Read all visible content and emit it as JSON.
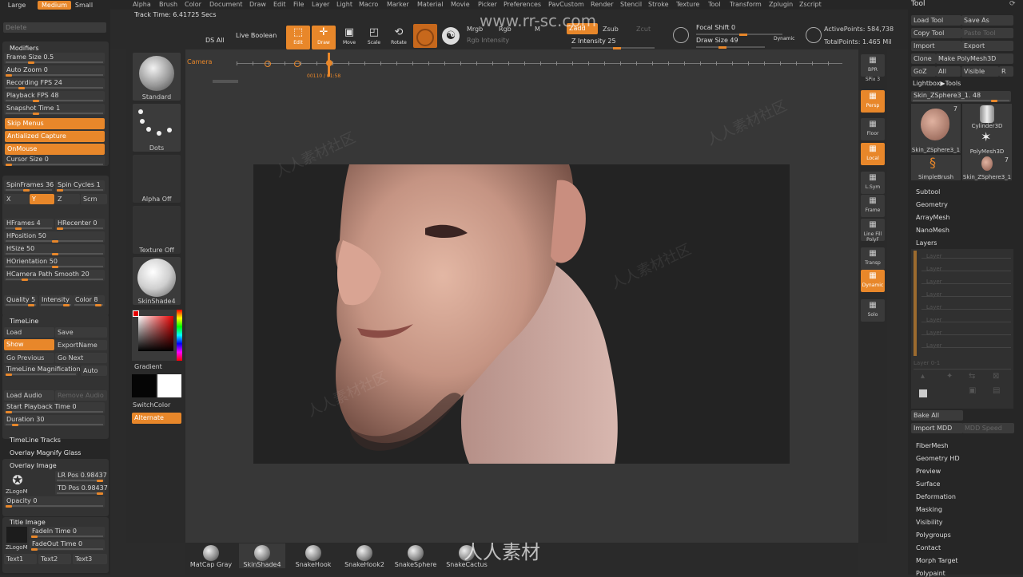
{
  "size_tabs": [
    "Large",
    "Medium",
    "Small"
  ],
  "top_menu": [
    "Alpha",
    "Brush",
    "Color",
    "Document",
    "Draw",
    "Edit",
    "File",
    "Layer",
    "Light",
    "Macro",
    "Marker",
    "Material",
    "Movie",
    "Picker",
    "Preferences",
    "PavCustom",
    "Render",
    "Stencil",
    "Stroke",
    "Texture",
    "Tool",
    "Transform",
    "Zplugin",
    "Zscript"
  ],
  "track_time": "Track Time: 6.41725 Secs",
  "watermark_top": "www.rr-sc.com",
  "watermark_cn": "人人素材社区",
  "watermark_logo": "人人素材",
  "left": {
    "delete": "Delete",
    "modifiers_title": "Modifiers",
    "frame_size": "Frame Size 0.5",
    "auto_zoom": "Auto Zoom 0",
    "recording_fps": "Recording FPS 24",
    "playback_fps": "Playback FPS 48",
    "snapshot_time": "Snapshot Time 1",
    "skip_menus": "Skip Menus",
    "antialized_capture": "Antialized Capture",
    "on_mouse": "OnMouse",
    "cursor_size": "Cursor Size 0",
    "spin_frames": "SpinFrames 36",
    "spin_cycles": "Spin Cycles 1",
    "axis_x": "X",
    "axis_y": "Y",
    "axis_z": "Z",
    "scrn": "Scrn",
    "hframes": "HFrames 4",
    "hrecenter": "HRecenter 0",
    "hposition": "HPosition 50",
    "hsize": "HSize 50",
    "horientation": "HOrientation 50",
    "hcamera": "HCamera Path Smooth 20",
    "quality": "Quality 5",
    "intensity": "Intensity",
    "color": "Color 8",
    "timeline_title": "TimeLine",
    "load": "Load",
    "save": "Save",
    "show": "Show",
    "export_name": "ExportName",
    "go_previous": "Go Previous",
    "go_next": "Go Next",
    "timeline_mag": "TimeLine Magnification",
    "auto": "Auto",
    "load_audio": "Load Audio",
    "remove_audio": "Remove Audio",
    "start_playback": "Start Playback Time 0",
    "duration": "Duration 30",
    "timeline_tracks": "TimeLine Tracks",
    "overlay_magnify": "Overlay Magnify Glass",
    "overlay_image": "Overlay Image",
    "zlogom": "ZLogoM",
    "lr_pos": "LR Pos 0.98437",
    "td_pos": "TD Pos 0.98437",
    "opacity": "Opacity 0",
    "title_image": "Title Image",
    "fadein": "FadeIn Time 0",
    "fadeout": "FadeOut Time 0",
    "zlogom2": "ZLogoM",
    "text1": "Text1",
    "text2": "Text2",
    "text3": "Text3"
  },
  "shelf": {
    "ds_all": "DS All",
    "live_boolean": "Live Boolean",
    "edit": "Edit",
    "draw": "Draw",
    "move": "Move",
    "scale": "Scale",
    "rotate": "Rotate",
    "mrgb": "Mrgb",
    "rgb": "Rgb",
    "m": "M",
    "rgb_intensity": "Rgb Intensity",
    "zadd": "Zadd",
    "zsub": "Zsub",
    "zcut": "Zcut",
    "z_intensity": "Z Intensity 25",
    "focal_shift": "Focal Shift 0",
    "draw_size": "Draw Size 49",
    "dynamic": "Dynamic",
    "active_points": "ActivePoints: 584,738",
    "total_points": "TotalPoints: 1.465 Mil",
    "camera": "Camera",
    "timeline_frame": "00110 / 01:58"
  },
  "materials": [
    {
      "label": "Standard"
    },
    {
      "label": "Dots"
    },
    {
      "label": "Alpha Off"
    },
    {
      "label": "Texture Off"
    },
    {
      "label": "SkinShade4"
    }
  ],
  "gradient": "Gradient",
  "switch_color": "SwitchColor",
  "alternate": "Alternate",
  "right_shelf": [
    "BPR",
    "SPix 3",
    "Persp",
    "Floor",
    "Local",
    "L.Sym",
    "Frame",
    "Line Fill PolyF",
    "Transp",
    "Dynamic",
    "Solo"
  ],
  "tool": {
    "title": "Tool",
    "load_tool": "Load Tool",
    "save_as": "Save As",
    "copy_tool": "Copy Tool",
    "paste_tool": "Paste Tool",
    "import": "Import",
    "export": "Export",
    "clone": "Clone",
    "make_polymesh": "Make PolyMesh3D",
    "goz": "GoZ",
    "all": "All",
    "visible": "Visible",
    "r": "R",
    "lightbox_tools": "Lightbox▶Tools",
    "current": "Skin_ZSphere3_1. 48",
    "thumbs": [
      {
        "label": "Skin_ZSphere3_1",
        "count": "7"
      },
      {
        "label": "Cylinder3D",
        "count": ""
      },
      {
        "label": "PolyMesh3D",
        "count": ""
      },
      {
        "label": "SimpleBrush",
        "count": ""
      },
      {
        "label": "Skin_ZSphere3_1",
        "count": "7"
      }
    ],
    "menus_top": [
      "Subtool",
      "Geometry",
      "ArrayMesh",
      "NanoMesh",
      "Layers"
    ],
    "layer_name": "Layer",
    "layer_count": "Layer 0-1",
    "bake_all": "Bake All",
    "import_mdd": "Import MDD",
    "mdd_speed": "MDD Speed",
    "menus_bottom": [
      "FiberMesh",
      "Geometry HD",
      "Preview",
      "Surface",
      "Deformation",
      "Masking",
      "Visibility",
      "Polygroups",
      "Contact",
      "Morph Target",
      "Polypaint"
    ]
  },
  "bottom_brushes": [
    "MatCap Gray",
    "SkinShade4",
    "SnakeHook",
    "SnakeHook2",
    "SnakeSphere",
    "SnakeCactus"
  ],
  "colors": {
    "accent": "#e8872a",
    "panel": "#333333",
    "canvas": "#373737",
    "doc": "#232323"
  }
}
